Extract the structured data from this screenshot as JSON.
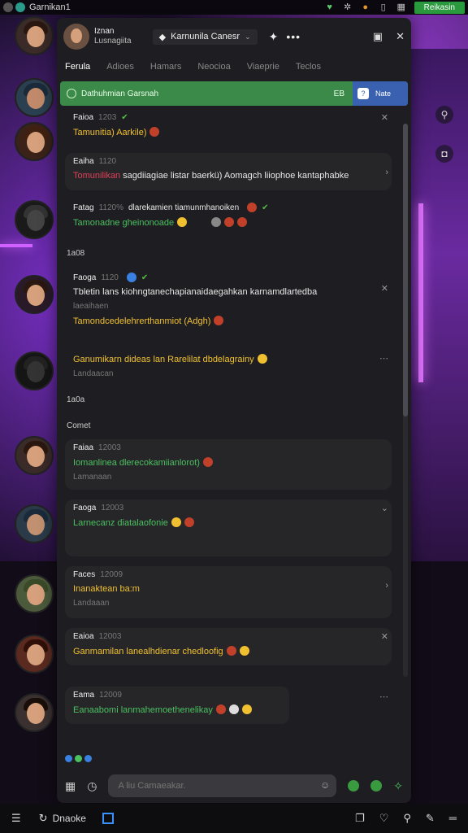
{
  "topbar": {
    "title": "Garnikan1",
    "button": "Reikasin"
  },
  "header": {
    "name": "Iznan",
    "subtitle": "Lusnagiita",
    "channel": "Karnunila Canesr",
    "star_icon": "star-icon",
    "more_icon": "more-icon"
  },
  "tabs": [
    "Ferula",
    "Adioes",
    "Hamars",
    "Neocioa",
    "Viaeprie",
    "Teclos"
  ],
  "banner": {
    "text": "Dathuhmian Garsnah",
    "badge": "EB",
    "action": "Nate"
  },
  "separators": {
    "first": "1a08",
    "second": "1a0a",
    "third": "Comet"
  },
  "messages": [
    {
      "author": "Faioa",
      "time": "1203",
      "body": "Tamunitia) Aarkile)",
      "sub": ""
    },
    {
      "author": "Eaiha",
      "time": "1120",
      "body_red": "Tomunilikan",
      "body_white": " sagdiiagiae listar baerkü) Aomagch liiophoe kantaphabke",
      "sub": ""
    },
    {
      "author": "Fatag",
      "time": "1120%",
      "head_extra": "dlarekamien tiamunmhanoiken",
      "body": "Tamonadne gheinonoade",
      "sub": ""
    },
    {
      "author": "Faoga",
      "time": "1120",
      "body": "Tbletin lans kiohngtanechapianaidaegahkan karnamdlartedba",
      "sub": "laeaihaen",
      "body2": "Tamondcedelehrerthanmiot (Adgh)"
    },
    {
      "author": "",
      "time": "",
      "body": "Ganumikarn dideas lan Rarelilat dbdelagrainy",
      "sub": "Landaacan"
    },
    {
      "author": "Faiaa",
      "time": "12003",
      "body": "Iomanlinea dlerecokamiianlorot)",
      "sub": "Lamanaan"
    },
    {
      "author": "Faoga",
      "time": "12003",
      "body": "Larnecanz diatalaofonie",
      "sub": ""
    },
    {
      "author": "Faces",
      "time": "12009",
      "body": "Inanaktean ba:m",
      "sub": "Landaaan"
    },
    {
      "author": "Eaioa",
      "time": "12003",
      "body": "Ganmamilan lanealhdienar chedloofig",
      "sub": ""
    },
    {
      "author": "Eama",
      "time": "12009",
      "body": "Eanaabomi lanmahemoethenelikay",
      "sub": ""
    }
  ],
  "composer": {
    "placeholder": "A liu Camaeakar."
  },
  "taskbar": {
    "label": "Dnaoke"
  },
  "colors": {
    "banner_green": "#3c8a4a",
    "banner_blue": "#3a60b0",
    "accent_yellow": "#f0c030",
    "accent_green": "#4ac060"
  }
}
